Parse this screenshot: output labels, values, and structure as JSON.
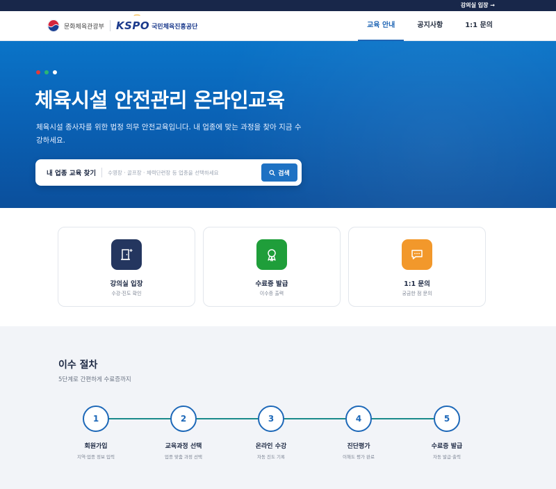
{
  "topbar": {
    "classroom_link": "강의실 입장 →"
  },
  "header": {
    "ministry": "문화체육관광부",
    "kspo_logo": "KSPO",
    "kspo_name": "국민체육진흥공단",
    "nav": [
      {
        "label": "교육 안내",
        "active": true
      },
      {
        "label": "공지사항",
        "active": false
      },
      {
        "label": "1:1 문의",
        "active": false
      }
    ]
  },
  "hero": {
    "dot_colors": [
      "#e03a3a",
      "#2bb673",
      "#ffffff"
    ],
    "title": "체육시설 안전관리 온라인교육",
    "description": "체육시설 종사자를 위한 법정 의무 안전교육입니다. 내 업종에 맞는 과정을 찾아 지금 수강하세요.",
    "search": {
      "label": "내 업종 교육 찾기",
      "placeholder": "수영장 · 골프장 · 체력단련장 등 업종을 선택하세요",
      "button": "검색"
    }
  },
  "cards": [
    {
      "title": "강의실 입장",
      "subtitle": "수강·진도 확인",
      "icon": "classroom-door-icon",
      "color": "#24365f"
    },
    {
      "title": "수료증 발급",
      "subtitle": "이수증 출력",
      "icon": "certificate-badge-icon",
      "color": "#1f9e3a"
    },
    {
      "title": "1:1 문의",
      "subtitle": "궁금한 점 문의",
      "icon": "chat-bubble-icon",
      "color": "#f2982b"
    }
  ],
  "process": {
    "title": "이수 절차",
    "subtitle": "5단계로 간편하게 수료증까지",
    "steps": [
      {
        "num": "1",
        "title": "회원가입",
        "desc": "지역·업종 정보 입력"
      },
      {
        "num": "2",
        "title": "교육과정 선택",
        "desc": "업종 맞춤 과정 선택"
      },
      {
        "num": "3",
        "title": "온라인 수강",
        "desc": "자동 진도 기록"
      },
      {
        "num": "4",
        "title": "진단평가",
        "desc": "이해도 평가 완료"
      },
      {
        "num": "5",
        "title": "수료증 발급",
        "desc": "자동 발급·출력"
      }
    ]
  }
}
